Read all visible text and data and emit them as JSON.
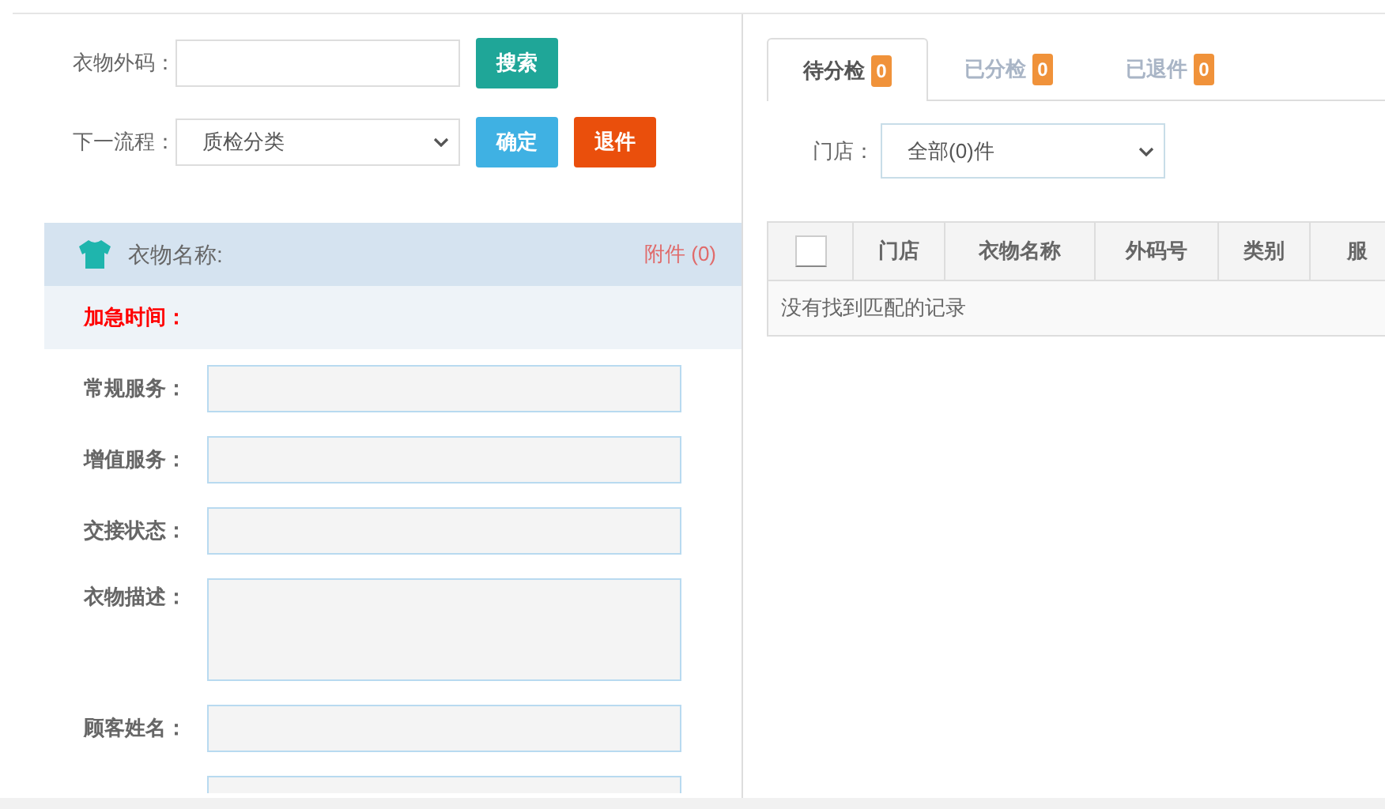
{
  "search": {
    "label": "衣物外码：",
    "button": "搜索"
  },
  "next_step": {
    "label": "下一流程：",
    "value": "质检分类",
    "confirm": "确定",
    "return": "退件"
  },
  "garment": {
    "title": "衣物名称:",
    "attachments": "附件 (0)",
    "urgent_label": "加急时间：",
    "fields": [
      {
        "label": "常规服务：",
        "kind": "input"
      },
      {
        "label": "增值服务：",
        "kind": "input"
      },
      {
        "label": "交接状态：",
        "kind": "input"
      },
      {
        "label": "衣物描述：",
        "kind": "textarea"
      },
      {
        "label": "顾客姓名：",
        "kind": "input"
      },
      {
        "kind": "partial"
      }
    ]
  },
  "tabs": [
    {
      "label": "待分检",
      "count": "0",
      "selected": true
    },
    {
      "label": "已分检",
      "count": "0",
      "selected": false
    },
    {
      "label": "已退件",
      "count": "0",
      "selected": false
    }
  ],
  "store_filter": {
    "label": "门店：",
    "value": "全部(0)件"
  },
  "table": {
    "select_all": {
      "checked": false
    },
    "columns": [
      "门店",
      "衣物名称",
      "外码号",
      "类别",
      "服"
    ],
    "empty_message": "没有找到匹配的记录"
  }
}
